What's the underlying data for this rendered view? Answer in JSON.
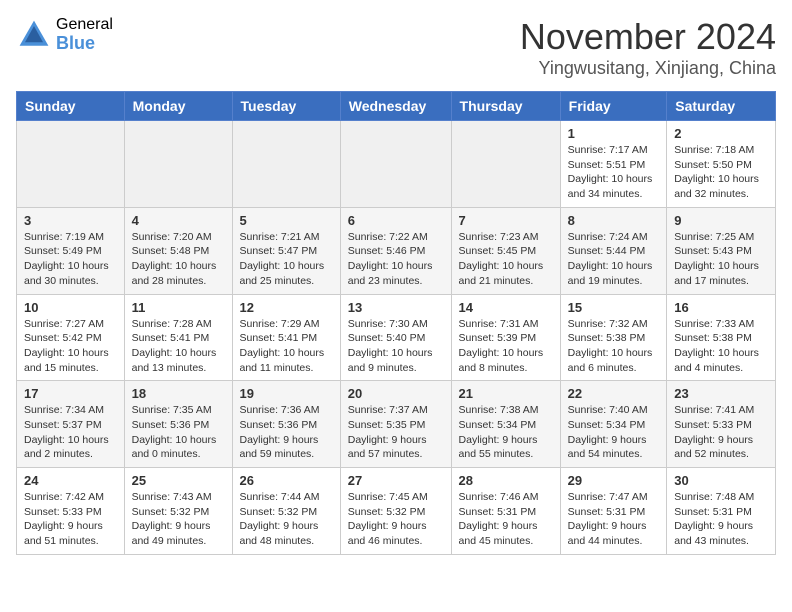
{
  "logo": {
    "general": "General",
    "blue": "Blue"
  },
  "title": "November 2024",
  "location": "Yingwusitang, Xinjiang, China",
  "days_of_week": [
    "Sunday",
    "Monday",
    "Tuesday",
    "Wednesday",
    "Thursday",
    "Friday",
    "Saturday"
  ],
  "weeks": [
    [
      {
        "day": "",
        "empty": true
      },
      {
        "day": "",
        "empty": true
      },
      {
        "day": "",
        "empty": true
      },
      {
        "day": "",
        "empty": true
      },
      {
        "day": "",
        "empty": true
      },
      {
        "day": "1",
        "sunrise": "7:17 AM",
        "sunset": "5:51 PM",
        "daylight": "10 hours and 34 minutes."
      },
      {
        "day": "2",
        "sunrise": "7:18 AM",
        "sunset": "5:50 PM",
        "daylight": "10 hours and 32 minutes."
      }
    ],
    [
      {
        "day": "3",
        "sunrise": "7:19 AM",
        "sunset": "5:49 PM",
        "daylight": "10 hours and 30 minutes."
      },
      {
        "day": "4",
        "sunrise": "7:20 AM",
        "sunset": "5:48 PM",
        "daylight": "10 hours and 28 minutes."
      },
      {
        "day": "5",
        "sunrise": "7:21 AM",
        "sunset": "5:47 PM",
        "daylight": "10 hours and 25 minutes."
      },
      {
        "day": "6",
        "sunrise": "7:22 AM",
        "sunset": "5:46 PM",
        "daylight": "10 hours and 23 minutes."
      },
      {
        "day": "7",
        "sunrise": "7:23 AM",
        "sunset": "5:45 PM",
        "daylight": "10 hours and 21 minutes."
      },
      {
        "day": "8",
        "sunrise": "7:24 AM",
        "sunset": "5:44 PM",
        "daylight": "10 hours and 19 minutes."
      },
      {
        "day": "9",
        "sunrise": "7:25 AM",
        "sunset": "5:43 PM",
        "daylight": "10 hours and 17 minutes."
      }
    ],
    [
      {
        "day": "10",
        "sunrise": "7:27 AM",
        "sunset": "5:42 PM",
        "daylight": "10 hours and 15 minutes."
      },
      {
        "day": "11",
        "sunrise": "7:28 AM",
        "sunset": "5:41 PM",
        "daylight": "10 hours and 13 minutes."
      },
      {
        "day": "12",
        "sunrise": "7:29 AM",
        "sunset": "5:41 PM",
        "daylight": "10 hours and 11 minutes."
      },
      {
        "day": "13",
        "sunrise": "7:30 AM",
        "sunset": "5:40 PM",
        "daylight": "10 hours and 9 minutes."
      },
      {
        "day": "14",
        "sunrise": "7:31 AM",
        "sunset": "5:39 PM",
        "daylight": "10 hours and 8 minutes."
      },
      {
        "day": "15",
        "sunrise": "7:32 AM",
        "sunset": "5:38 PM",
        "daylight": "10 hours and 6 minutes."
      },
      {
        "day": "16",
        "sunrise": "7:33 AM",
        "sunset": "5:38 PM",
        "daylight": "10 hours and 4 minutes."
      }
    ],
    [
      {
        "day": "17",
        "sunrise": "7:34 AM",
        "sunset": "5:37 PM",
        "daylight": "10 hours and 2 minutes."
      },
      {
        "day": "18",
        "sunrise": "7:35 AM",
        "sunset": "5:36 PM",
        "daylight": "10 hours and 0 minutes."
      },
      {
        "day": "19",
        "sunrise": "7:36 AM",
        "sunset": "5:36 PM",
        "daylight": "9 hours and 59 minutes."
      },
      {
        "day": "20",
        "sunrise": "7:37 AM",
        "sunset": "5:35 PM",
        "daylight": "9 hours and 57 minutes."
      },
      {
        "day": "21",
        "sunrise": "7:38 AM",
        "sunset": "5:34 PM",
        "daylight": "9 hours and 55 minutes."
      },
      {
        "day": "22",
        "sunrise": "7:40 AM",
        "sunset": "5:34 PM",
        "daylight": "9 hours and 54 minutes."
      },
      {
        "day": "23",
        "sunrise": "7:41 AM",
        "sunset": "5:33 PM",
        "daylight": "9 hours and 52 minutes."
      }
    ],
    [
      {
        "day": "24",
        "sunrise": "7:42 AM",
        "sunset": "5:33 PM",
        "daylight": "9 hours and 51 minutes."
      },
      {
        "day": "25",
        "sunrise": "7:43 AM",
        "sunset": "5:32 PM",
        "daylight": "9 hours and 49 minutes."
      },
      {
        "day": "26",
        "sunrise": "7:44 AM",
        "sunset": "5:32 PM",
        "daylight": "9 hours and 48 minutes."
      },
      {
        "day": "27",
        "sunrise": "7:45 AM",
        "sunset": "5:32 PM",
        "daylight": "9 hours and 46 minutes."
      },
      {
        "day": "28",
        "sunrise": "7:46 AM",
        "sunset": "5:31 PM",
        "daylight": "9 hours and 45 minutes."
      },
      {
        "day": "29",
        "sunrise": "7:47 AM",
        "sunset": "5:31 PM",
        "daylight": "9 hours and 44 minutes."
      },
      {
        "day": "30",
        "sunrise": "7:48 AM",
        "sunset": "5:31 PM",
        "daylight": "9 hours and 43 minutes."
      }
    ]
  ]
}
